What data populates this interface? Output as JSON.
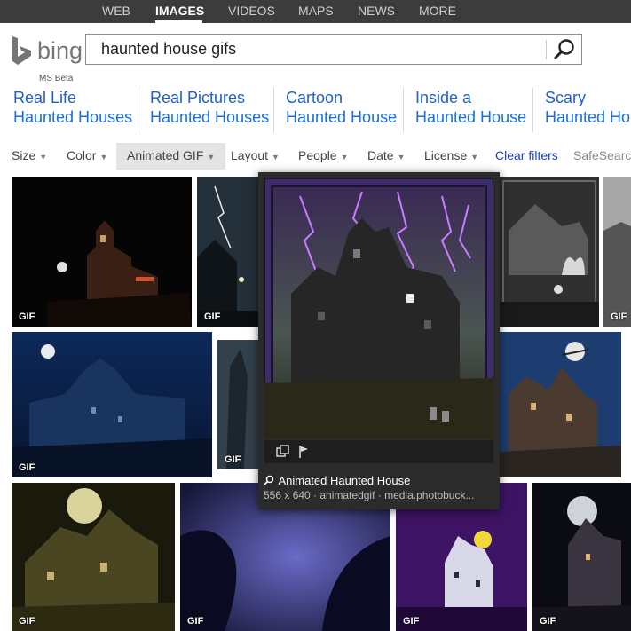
{
  "topnav": {
    "items": [
      "WEB",
      "IMAGES",
      "VIDEOS",
      "MAPS",
      "NEWS",
      "MORE"
    ],
    "active": "IMAGES"
  },
  "brand": {
    "logo_text": "bing",
    "tag": "MS Beta"
  },
  "search": {
    "query": "haunted house gifs",
    "icon": "search-icon"
  },
  "related": [
    {
      "line1": "Real Life",
      "line2": "Haunted Houses"
    },
    {
      "line1": "Real Pictures",
      "line2": "Haunted Houses"
    },
    {
      "line1": "Cartoon",
      "line2": "Haunted House"
    },
    {
      "line1": "Inside a",
      "line2": "Haunted House"
    },
    {
      "line1": "Scary",
      "line2": "Haunted House"
    }
  ],
  "filters": {
    "size": "Size",
    "color": "Color",
    "type": "Animated GIF",
    "layout": "Layout",
    "people": "People",
    "date": "Date",
    "license": "License",
    "clear": "Clear filters",
    "safesearch": "SafeSearch"
  },
  "thumb_badge": "GIF",
  "popup": {
    "title": "Animated Haunted House",
    "meta": "556 x 640 · animatedgif · media.photobuck...",
    "icons": [
      "copy-icon",
      "flag-icon",
      "search-icon"
    ]
  },
  "colors": {
    "link": "#1a6fd8",
    "nav_bg": "#3c3c3c",
    "lightning": "#c77dff"
  }
}
